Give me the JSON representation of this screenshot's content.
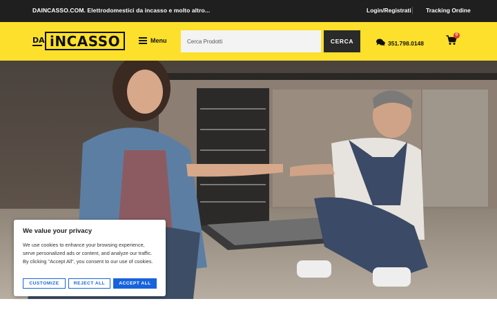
{
  "topbar": {
    "tagline": "DAINCASSO.COM. Elettrodomestici da incasso e molto altro...",
    "login": "Login/Registrati",
    "tracking": "Tracking Ordine"
  },
  "header": {
    "logo_da": "DA",
    "logo_main": "iNCASSO",
    "menu_label": "Menu",
    "search_placeholder": "Cerca Prodotti",
    "search_button": "CERCA",
    "phone": "351.798.0148",
    "cart_count": "0"
  },
  "cookie_banner": {
    "title": "We value your privacy",
    "text": "We use cookies to enhance your browsing experience, serve personalized ads or content, and analyze our traffic. By clicking \"Accept All\", you consent to our use of cookies.",
    "customize": "CUSTOMIZE",
    "reject": "REJECT ALL",
    "accept": "ACCEPT ALL"
  },
  "colors": {
    "brand_yellow": "#fde02b",
    "topbar_dark": "#1f1f1f",
    "accent_blue": "#1863dc",
    "cart_badge": "#e23a2c"
  },
  "icons": [
    "hamburger-icon",
    "chat-bubbles-icon",
    "shopping-cart-icon"
  ]
}
